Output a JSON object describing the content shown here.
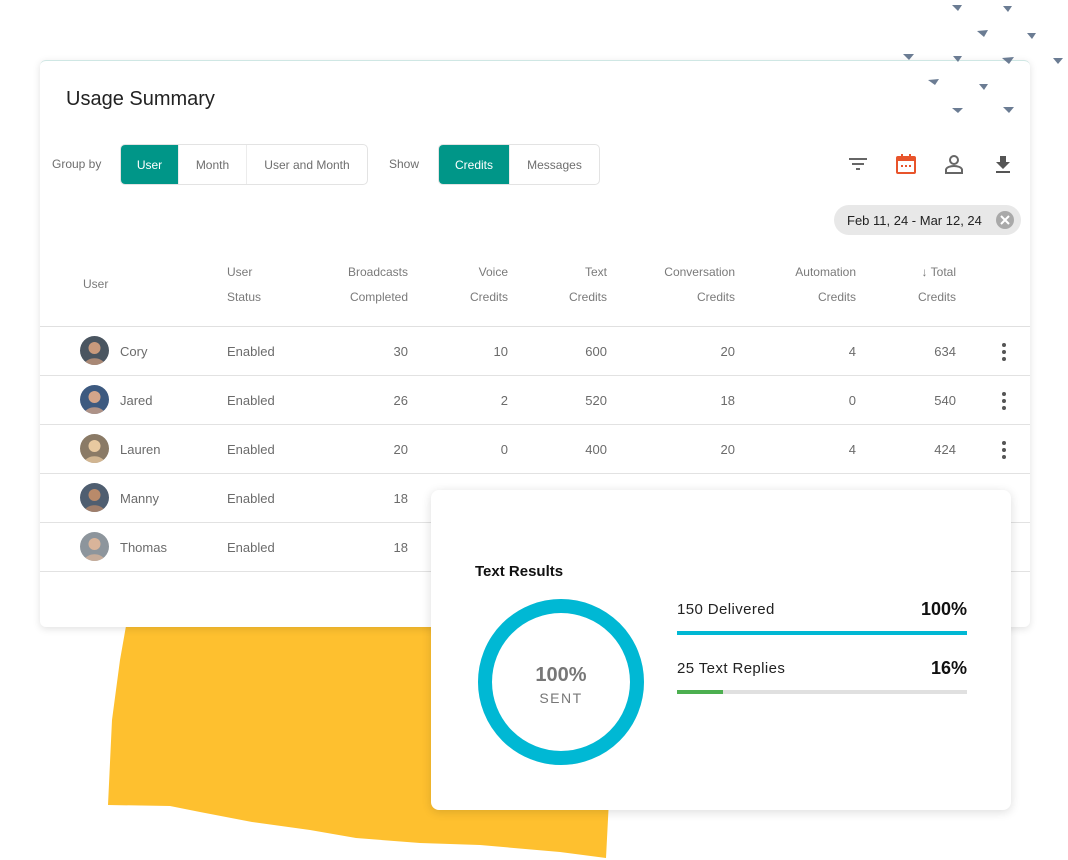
{
  "card": {
    "title": "Usage Summary"
  },
  "toolbar": {
    "group_by_label": "Group by",
    "group_by_options": [
      {
        "label": "User",
        "active": true
      },
      {
        "label": "Month",
        "active": false
      },
      {
        "label": "User and Month",
        "active": false
      }
    ],
    "show_label": "Show",
    "show_options": [
      {
        "label": "Credits",
        "active": true
      },
      {
        "label": "Messages",
        "active": false
      }
    ],
    "icons": [
      "filter-icon",
      "calendar-icon",
      "person-icon",
      "download-icon"
    ],
    "accent_color": "#009688",
    "calendar_color": "#e8542b"
  },
  "date_filter": {
    "label": "Feb 11, 24 - Mar 12, 24"
  },
  "table": {
    "columns": [
      {
        "line1": "User",
        "line2": ""
      },
      {
        "line1": "User",
        "line2": "Status"
      },
      {
        "line1": "Broadcasts",
        "line2": "Completed"
      },
      {
        "line1": "Voice",
        "line2": "Credits"
      },
      {
        "line1": "Text",
        "line2": "Credits"
      },
      {
        "line1": "Conversation",
        "line2": "Credits"
      },
      {
        "line1": "Automation",
        "line2": "Credits"
      },
      {
        "line1": "↓ Total",
        "line2": "Credits"
      }
    ],
    "sort_indicator": "↓",
    "rows": [
      {
        "name": "Cory",
        "status": "Enabled",
        "broadcasts": "30",
        "voice": "10",
        "text": "600",
        "conversation": "20",
        "automation": "4",
        "total": "634"
      },
      {
        "name": "Jared",
        "status": "Enabled",
        "broadcasts": "26",
        "voice": "2",
        "text": "520",
        "conversation": "18",
        "automation": "0",
        "total": "540"
      },
      {
        "name": "Lauren",
        "status": "Enabled",
        "broadcasts": "20",
        "voice": "0",
        "text": "400",
        "conversation": "20",
        "automation": "4",
        "total": "424"
      },
      {
        "name": "Manny",
        "status": "Enabled",
        "broadcasts": "18",
        "voice": "",
        "text": "",
        "conversation": "",
        "automation": "",
        "total": ""
      },
      {
        "name": "Thomas",
        "status": "Enabled",
        "broadcasts": "18",
        "voice": "",
        "text": "",
        "conversation": "",
        "automation": "",
        "total": ""
      }
    ]
  },
  "results": {
    "title": "Text Results",
    "donut": {
      "value": "100%",
      "label": "SENT",
      "fraction": 1.0,
      "color": "#00b8d4"
    },
    "metrics": [
      {
        "label": "150 Delivered",
        "pct": "100%",
        "fraction": 1.0,
        "color": "#00b8d4"
      },
      {
        "label": "25 Text Replies",
        "pct": "16%",
        "fraction": 0.16,
        "color": "#4caf50"
      }
    ]
  }
}
